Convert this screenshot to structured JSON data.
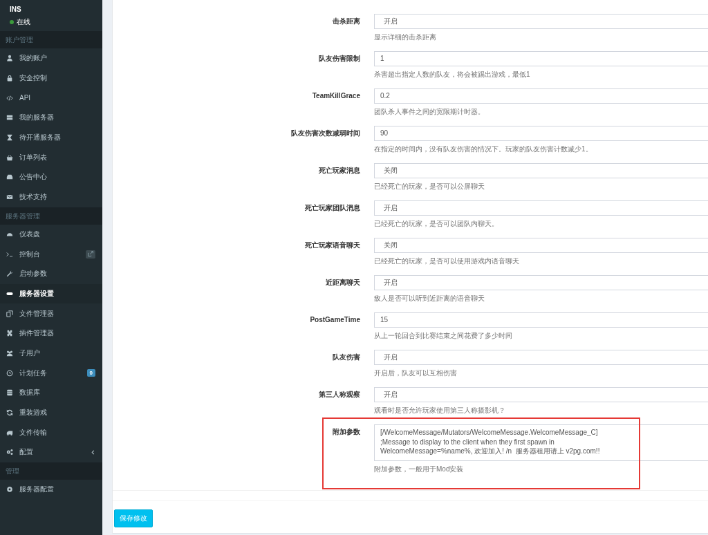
{
  "sidebar": {
    "user": {
      "name": "INS",
      "status": "在线",
      "online": true
    },
    "sections": [
      {
        "title": "账户管理",
        "items": [
          {
            "label": "我的账户",
            "selected": false
          },
          {
            "label": "安全控制",
            "selected": false
          },
          {
            "label": "API",
            "selected": false
          },
          {
            "label": "我的服务器",
            "selected": false
          },
          {
            "label": "待开通服务器",
            "selected": false
          },
          {
            "label": "订单列表",
            "selected": false
          },
          {
            "label": "公告中心",
            "selected": false
          },
          {
            "label": "技术支持",
            "selected": false
          }
        ]
      },
      {
        "title": "服务器管理",
        "items": [
          {
            "label": "仪表盘",
            "selected": false
          },
          {
            "label": "控制台",
            "selected": false,
            "external_link": true
          },
          {
            "label": "启动参数",
            "selected": false
          },
          {
            "label": "服务器设置",
            "selected": true
          },
          {
            "label": "文件管理器",
            "selected": false
          },
          {
            "label": "插件管理器",
            "selected": false
          },
          {
            "label": "子用户",
            "selected": false
          },
          {
            "label": "计划任务",
            "selected": false,
            "badge": "0"
          },
          {
            "label": "数据库",
            "selected": false
          },
          {
            "label": "重装游戏",
            "selected": false
          },
          {
            "label": "文件传输",
            "selected": false
          },
          {
            "label": "配置",
            "selected": false,
            "expanded": false
          }
        ]
      },
      {
        "title": "管理",
        "items": [
          {
            "label": "服务器配置",
            "selected": false
          }
        ]
      }
    ]
  },
  "form": {
    "fields": [
      {
        "label": "击杀距离",
        "kind": "select",
        "value": "开启",
        "hint": "显示详细的击杀距离"
      },
      {
        "label": "队友伤害限制",
        "kind": "input",
        "value": "1",
        "hint": "杀害超出指定人数的队友，将会被踢出游戏，最低1"
      },
      {
        "label": "TeamKillGrace",
        "kind": "input",
        "value": "0.2",
        "hint": "团队杀人事件之间的宽限期计时器。"
      },
      {
        "label": "队友伤害次数减弱时间",
        "kind": "input",
        "value": "90",
        "hint": "在指定的时间内，没有队友伤害的情况下。玩家的队友伤害计数减少1。"
      },
      {
        "label": "死亡玩家消息",
        "kind": "select",
        "value": "关闭",
        "hint": "已经死亡的玩家，是否可以公屏聊天"
      },
      {
        "label": "死亡玩家团队消息",
        "kind": "select",
        "value": "开启",
        "hint": "已经死亡的玩家，是否可以团队内聊天。"
      },
      {
        "label": "死亡玩家语音聊天",
        "kind": "select",
        "value": "关闭",
        "hint": "已经死亡的玩家，是否可以使用游戏内语音聊天"
      },
      {
        "label": "近距离聊天",
        "kind": "select",
        "value": "开启",
        "hint": "敌人是否可以听到近距离的语音聊天"
      },
      {
        "label": "PostGameTime",
        "kind": "input",
        "value": "15",
        "hint": "从上一轮回合到比赛结束之间花费了多少时间"
      },
      {
        "label": "队友伤害",
        "kind": "select",
        "value": "开启",
        "hint": "开启后，队友可以互相伤害"
      },
      {
        "label": "第三人称观察",
        "kind": "select",
        "value": "开启",
        "hint": "观看时是否允许玩家使用第三人称摄影机？"
      },
      {
        "label": "附加参数",
        "kind": "textarea",
        "value": "[/WelcomeMessage/Mutators/WelcomeMessage.WelcomeMessage_C]\n;Message to display to the client when they first spawn in\nWelcomeMessage=%name%, 欢迎加入! /n  服务器租用请上 v2pg.com!!",
        "hint": "附加参数，一般用于Mod安装",
        "highlighted": true
      }
    ]
  },
  "save_button": "保存修改"
}
